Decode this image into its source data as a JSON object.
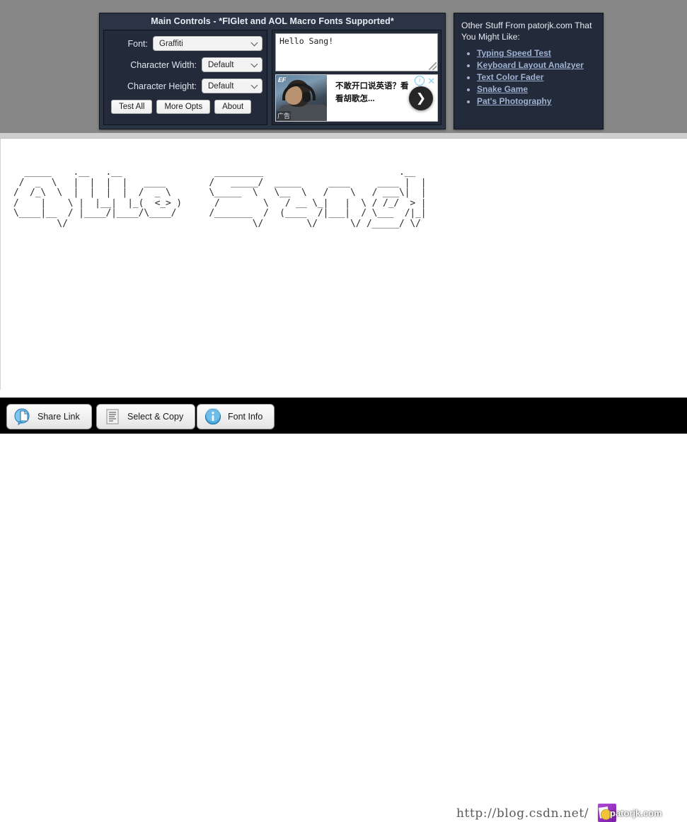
{
  "controls": {
    "title": "Main Controls - *FIGlet and AOL Macro Fonts Supported*",
    "font_label": "Font:",
    "font_value": "Graffiti",
    "char_width_label": "Character Width:",
    "char_width_value": "Default",
    "char_height_label": "Character Height:",
    "char_height_value": "Default",
    "buttons": [
      {
        "label": "Test All"
      },
      {
        "label": "More Opts"
      },
      {
        "label": "About"
      }
    ]
  },
  "input": {
    "text": "Hello Sang!"
  },
  "ad": {
    "brand": "EF",
    "line1": "不敢开口说英语？看",
    "line2": "看胡歌怎...",
    "ad_marker": "广告",
    "info_icon": "i",
    "close_icon": "✕",
    "next_icon": "❯"
  },
  "other_stuff": {
    "title": "Other Stuff From patorjk.com That You Might Like:",
    "links": [
      {
        "label": "Typing Speed Test"
      },
      {
        "label": "Keyboard Layout Analzyer"
      },
      {
        "label": "Text Color Fader"
      },
      {
        "label": "Snake Game"
      },
      {
        "label": "Pat's Photography"
      }
    ]
  },
  "ascii_art": {
    "font": "Graffiti",
    "source_text": "Hello Sang!",
    "lines": [
      "  _____    .__   .__                 _________                         .__ ",
      " /  _  \\   |  |  |  |   ____        /   _____/  _____     ____     ____ |  |",
      "/  /_\\  \\  |  |  |  |  /  _ \\       \\_____  \\   \\__  \\   /    \\   / ___\\|  |",
      "/    |    \\ |  |__|  |_(  <_> )      /        \\   / __ \\_|   |  \\ / /_/  > |",
      "\\____|__  / |____/|____/\\____/      /_______  /  (____  /|___|  / \\___  /|_|",
      "        \\/                                  \\/        \\/      \\/ /_____/ \\/ "
    ],
    "rendered": "  _____    .__   .__                 _________                         .__ \n /  _  \\   |  |  |  |   ____        /   _____/  _____     ____     ____ |  |\n/  /_\\  \\  |  |  |  |  /  _ \\       \\_____  \\   \\__  \\   /    \\   / ___\\|  |\n/    |    \\ |  |__|  |_(  <_> )      /        \\   / __ \\_|   |  \\ / /_/  > |\n\\____|__  / |____/|____/\\____/      /_______  /  (____  /|___|  / \\___  /|_|\n        \\/                                  \\/        \\/      \\/ /_____/ \\/ "
  },
  "toolbar": {
    "share_link": "Share Link",
    "select_copy": "Select & Copy",
    "font_info": "Font Info"
  },
  "watermark": {
    "url": "http://blog.csdn.net/",
    "site": "patorjk.com"
  },
  "colors": {
    "panel_bg": "#232b3a",
    "panel_head": "#2b3445",
    "link": "#9fb2d2",
    "page_gray": "#878787"
  }
}
